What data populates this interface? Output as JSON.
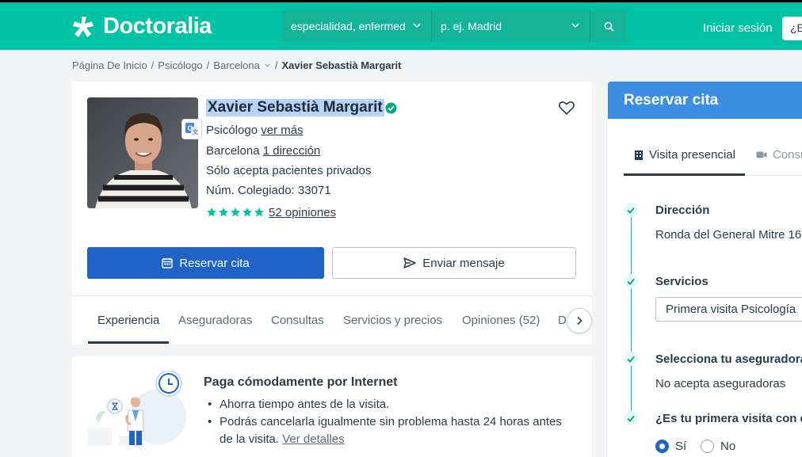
{
  "header": {
    "brand": "Doctoralia",
    "specialty_placeholder": "especialidad, enfermed",
    "location_placeholder": "p. ej. Madrid",
    "login_label": "Iniciar sesión",
    "register_label": "¿E",
    "brand_color": "#00c3a5"
  },
  "breadcrumb": {
    "items": [
      "Página De Inicio",
      "Psicólogo",
      "Barcelona",
      "Xavier Sebastià Margarit"
    ],
    "separator": "/"
  },
  "profile": {
    "name": "Xavier Sebastià Margarit",
    "specialty": "Psicólogo",
    "specialty_more": "ver más",
    "city": "Barcelona",
    "address_link": "1 dirección",
    "private_note": "Sólo acepta pacientes privados",
    "license": "Núm. Colegiado: 33071",
    "rating_stars": 5,
    "reviews_link": "52 opiniones",
    "book_button": "Reservar cita",
    "message_button": "Enviar mensaje"
  },
  "tabs": {
    "items": [
      "Experiencia",
      "Aseguradoras",
      "Consultas",
      "Servicios y precios",
      "Opiniones (52)",
      "D"
    ],
    "active": "Experiencia"
  },
  "payment": {
    "title": "Paga cómodamente por Internet",
    "bullets": [
      "Ahorra tiempo antes de la visita.",
      "Podrás cancelarla igualmente sin problema hasta 24 horas antes"
    ],
    "bullet2_cont": "de la visita.",
    "details_link": "Ver detalles"
  },
  "booking": {
    "title": "Reservar cita",
    "tab_in_person": "Visita presencial",
    "tab_online": "Consu",
    "address_title": "Dirección",
    "address_value": "Ronda del General Mitre 16",
    "services_title": "Servicios",
    "services_selected": "Primera visita Psicología",
    "insurance_title": "Selecciona tu aseguradora",
    "insurance_value": "No acepta aseguradoras",
    "first_visit_title": "¿Es tu primera visita con es",
    "yes_label": "Sí",
    "no_label": "No",
    "header_color": "#3b8ee3"
  }
}
